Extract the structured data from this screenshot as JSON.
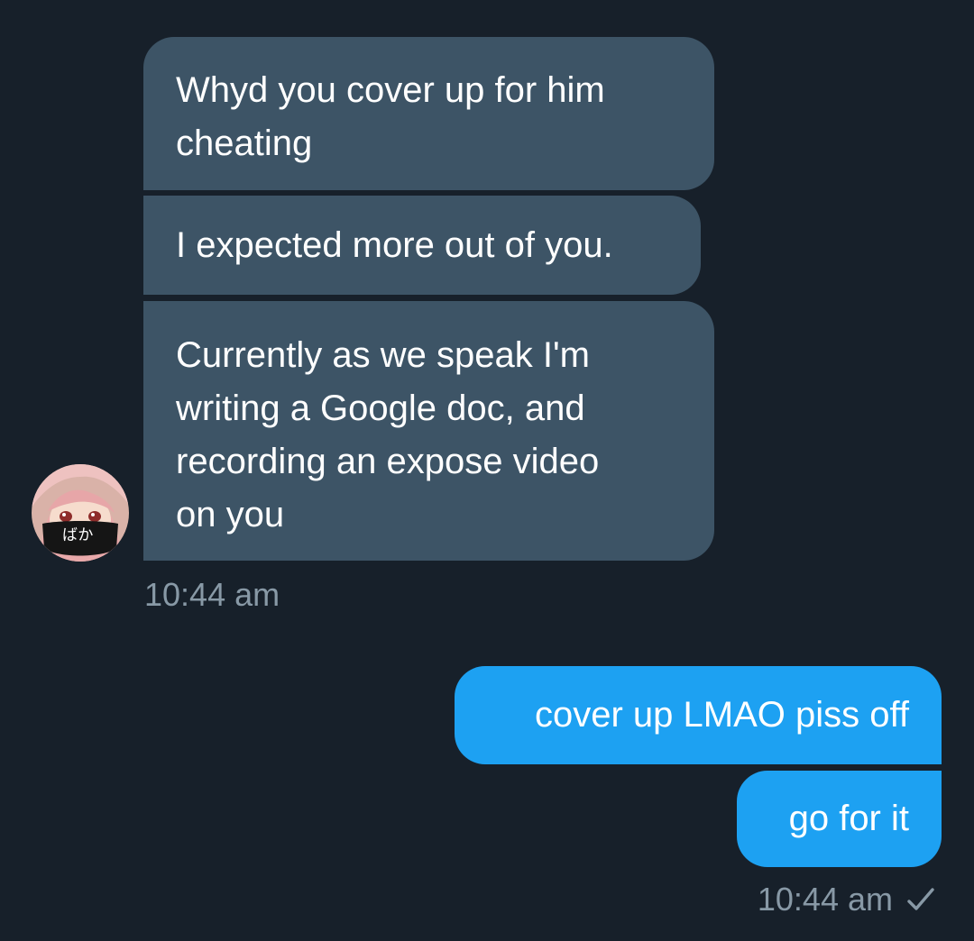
{
  "conversation": {
    "incoming": {
      "messages": [
        "Whyd you cover up for him\ncheating",
        "I expected more out of you.",
        "Currently as we speak I'm\nwriting a Google doc, and\nrecording an expose video\non you"
      ],
      "timestamp": "10:44 am",
      "avatar_text": "ばか"
    },
    "outgoing": {
      "messages": [
        "cover up LMAO piss off",
        "go for it"
      ],
      "timestamp": "10:44 am"
    }
  },
  "colors": {
    "background": "#17202a",
    "incoming_bubble": "#3d5466",
    "outgoing_bubble": "#1da1f2",
    "timestamp": "#8899a6"
  },
  "icons": {
    "read_status": "checkmark-icon"
  }
}
